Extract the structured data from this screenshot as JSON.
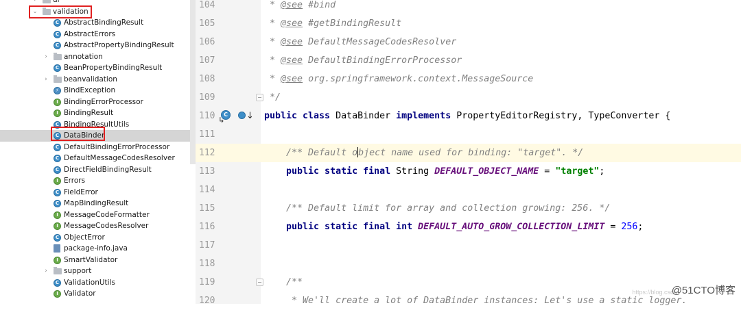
{
  "tree": {
    "items": [
      {
        "label": "ui",
        "kind": "folder",
        "indent": 1,
        "arrow": ">"
      },
      {
        "label": "validation",
        "kind": "folder",
        "indent": 1,
        "arrow": "v"
      },
      {
        "label": "AbstractBindingResult",
        "kind": "class",
        "indent": 2
      },
      {
        "label": "AbstractErrors",
        "kind": "class",
        "indent": 2
      },
      {
        "label": "AbstractPropertyBindingResult",
        "kind": "class",
        "indent": 2
      },
      {
        "label": "annotation",
        "kind": "folder",
        "indent": 2,
        "arrow": ">"
      },
      {
        "label": "BeanPropertyBindingResult",
        "kind": "class",
        "indent": 2
      },
      {
        "label": "beanvalidation",
        "kind": "folder",
        "indent": 2,
        "arrow": ">"
      },
      {
        "label": "BindException",
        "kind": "exception",
        "indent": 2
      },
      {
        "label": "BindingErrorProcessor",
        "kind": "interface",
        "indent": 2
      },
      {
        "label": "BindingResult",
        "kind": "interface",
        "indent": 2
      },
      {
        "label": "BindingResultUtils",
        "kind": "class",
        "indent": 2
      },
      {
        "label": "DataBinder",
        "kind": "class",
        "indent": 2,
        "selected": true
      },
      {
        "label": "DefaultBindingErrorProcessor",
        "kind": "class",
        "indent": 2
      },
      {
        "label": "DefaultMessageCodesResolver",
        "kind": "class",
        "indent": 2
      },
      {
        "label": "DirectFieldBindingResult",
        "kind": "class",
        "indent": 2
      },
      {
        "label": "Errors",
        "kind": "interface",
        "indent": 2
      },
      {
        "label": "FieldError",
        "kind": "class",
        "indent": 2
      },
      {
        "label": "MapBindingResult",
        "kind": "class",
        "indent": 2
      },
      {
        "label": "MessageCodeFormatter",
        "kind": "interface",
        "indent": 2
      },
      {
        "label": "MessageCodesResolver",
        "kind": "interface",
        "indent": 2
      },
      {
        "label": "ObjectError",
        "kind": "class",
        "indent": 2
      },
      {
        "label": "package-info.java",
        "kind": "javafile",
        "indent": 2
      },
      {
        "label": "SmartValidator",
        "kind": "interface",
        "indent": 2
      },
      {
        "label": "support",
        "kind": "folder",
        "indent": 2,
        "arrow": ">"
      },
      {
        "label": "ValidationUtils",
        "kind": "class",
        "indent": 2
      },
      {
        "label": "Validator",
        "kind": "interface",
        "indent": 2
      }
    ],
    "bottom_partial": "..."
  },
  "editor": {
    "lines": [
      {
        "n": "104",
        "tokens": [
          [
            "doc",
            " * "
          ],
          [
            "tag",
            "@see"
          ],
          [
            "doc",
            " #bind"
          ]
        ]
      },
      {
        "n": "105",
        "tokens": [
          [
            "doc",
            " * "
          ],
          [
            "tag",
            "@see"
          ],
          [
            "doc",
            " #getBindingResult"
          ]
        ]
      },
      {
        "n": "106",
        "tokens": [
          [
            "doc",
            " * "
          ],
          [
            "tag",
            "@see"
          ],
          [
            "doc",
            " DefaultMessageCodesResolver"
          ]
        ]
      },
      {
        "n": "107",
        "tokens": [
          [
            "doc",
            " * "
          ],
          [
            "tag",
            "@see"
          ],
          [
            "doc",
            " DefaultBindingErrorProcessor"
          ]
        ]
      },
      {
        "n": "108",
        "tokens": [
          [
            "doc",
            " * "
          ],
          [
            "tag",
            "@see"
          ],
          [
            "doc",
            " org.springframework.context.MessageSource"
          ]
        ]
      },
      {
        "n": "109",
        "tokens": [
          [
            "doc",
            " */"
          ]
        ],
        "fold": true
      },
      {
        "n": "110",
        "tokens": [
          [
            "kw",
            "public class "
          ],
          [
            "plain",
            "DataBinder "
          ],
          [
            "kw",
            "implements "
          ],
          [
            "plain",
            "PropertyEditorRegistry, TypeConverter {"
          ]
        ],
        "gutter_icons": true
      },
      {
        "n": "111",
        "tokens": []
      },
      {
        "n": "112",
        "tokens": [
          [
            "cmt",
            "    /** Default o"
          ],
          [
            "caret",
            ""
          ],
          [
            "cmt",
            "bject name used for binding: \"target\". */"
          ]
        ],
        "highlight": true
      },
      {
        "n": "113",
        "tokens": [
          [
            "kw",
            "    public static final "
          ],
          [
            "plain",
            "String "
          ],
          [
            "const",
            "DEFAULT_OBJECT_NAME"
          ],
          [
            "plain",
            " = "
          ],
          [
            "str",
            "\"target\""
          ],
          [
            "plain",
            ";"
          ]
        ]
      },
      {
        "n": "114",
        "tokens": []
      },
      {
        "n": "115",
        "tokens": [
          [
            "cmt",
            "    /** Default limit for array and collection growing: 256. */"
          ]
        ]
      },
      {
        "n": "116",
        "tokens": [
          [
            "kw",
            "    public static final int "
          ],
          [
            "const",
            "DEFAULT_AUTO_GROW_COLLECTION_LIMIT"
          ],
          [
            "plain",
            " = "
          ],
          [
            "num",
            "256"
          ],
          [
            "plain",
            ";"
          ]
        ]
      },
      {
        "n": "117",
        "tokens": []
      },
      {
        "n": "118",
        "tokens": []
      },
      {
        "n": "119",
        "tokens": [
          [
            "doc",
            "    /**"
          ]
        ],
        "fold": true
      },
      {
        "n": "120",
        "tokens": [
          [
            "doc",
            "     * We'll create a lot of DataBinder instances: Let's use a static logger."
          ]
        ]
      }
    ]
  },
  "watermark": {
    "small": "https://blog.csdn",
    "big": "@51CTO博客"
  },
  "icons": {
    "class_glyph": "C",
    "interface_glyph": "I",
    "exception_glyph": "⚡",
    "override_arrow": "↳",
    "implement_arrow": "↓"
  }
}
